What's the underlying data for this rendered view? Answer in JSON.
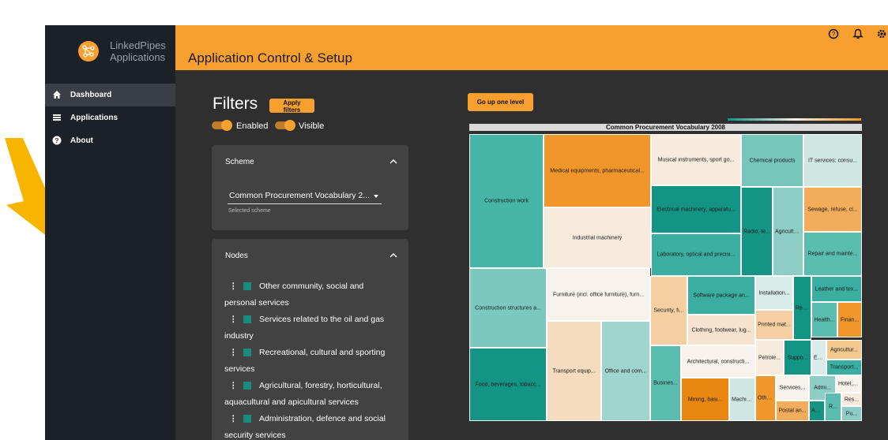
{
  "brand": {
    "line1": "LinkedPipes",
    "line2": "Applications"
  },
  "topbar": {
    "title": "Application Control & Setup",
    "icons": [
      "help-icon",
      "bell-icon",
      "gear-icon"
    ]
  },
  "nav": [
    {
      "label": "Dashboard",
      "icon": "home-icon",
      "active": true
    },
    {
      "label": "Applications",
      "icon": "list-icon",
      "active": false
    },
    {
      "label": "About",
      "icon": "help-circle-icon",
      "active": false
    }
  ],
  "filters": {
    "title": "Filters",
    "apply_label": "Apply filters",
    "enabled_label": "Enabled",
    "visible_label": "Visible"
  },
  "scheme": {
    "title": "Scheme",
    "value": "Common Procurement Vocabulary 2...",
    "helper": "Selected scheme"
  },
  "nodes": {
    "title": "Nodes",
    "items": [
      {
        "first": "Other community, social and",
        "rest": "personal services"
      },
      {
        "first": "Services related to the oil and gas",
        "rest": "industry"
      },
      {
        "first": "Recreational, cultural and sporting",
        "rest": "services"
      },
      {
        "first": "Agricultural, forestry, horticultural,",
        "rest": "aquacultural and apicultural services"
      },
      {
        "first": "Administration, defence and social",
        "rest": "security services"
      }
    ]
  },
  "viz": {
    "go_up_label": "Go up one level",
    "title": "Common Procurement Vocabulary 2008",
    "colors": {
      "accent": "#f7a030",
      "sidebar": "#1c2127",
      "background": "#2f2f2f"
    },
    "cells": [
      {
        "label": "Construction work",
        "color": "#45b5a8"
      },
      {
        "label": "Medical equipments, pharmaceutical...",
        "color": "#f0962a"
      },
      {
        "label": "Industrial machinery",
        "color": "#f7ebdd"
      },
      {
        "label": "Musical instruments, sport go...",
        "color": "#f7ebdd"
      },
      {
        "label": "Electrical machinery, apparatu...",
        "color": "#149484"
      },
      {
        "label": "Laboratory, optical and precisi...",
        "color": "#3aaea1"
      },
      {
        "label": "Chemical products",
        "color": "#76c6bc"
      },
      {
        "label": "IT services: consu...",
        "color": "#cfe7e3"
      },
      {
        "label": "Radio, te...",
        "color": "#149484"
      },
      {
        "label": "Agricultu...",
        "color": "#8dcdc5"
      },
      {
        "label": "Sewage, refuse, cl...",
        "color": "#f3ac5a"
      },
      {
        "label": "Repair and mainte...",
        "color": "#5bbcb0"
      },
      {
        "label": "Construction structures a...",
        "color": "#7ac8be"
      },
      {
        "label": "Furniture (incl. office furniture), furn...",
        "color": "#f7f2ec"
      },
      {
        "label": "Security, fi...",
        "color": "#f5cfa2"
      },
      {
        "label": "Software package an...",
        "color": "#3aaea1"
      },
      {
        "label": "Installation...",
        "color": "#d8ece9"
      },
      {
        "label": "Rec...",
        "color": "#149484"
      },
      {
        "label": "Leather and tex...",
        "color": "#3aaea1"
      },
      {
        "label": "Clothing, footwear, lug...",
        "color": "#f5e3cf"
      },
      {
        "label": "Printed mat...",
        "color": "#f5cfa2"
      },
      {
        "label": "Health...",
        "color": "#5bbcb0"
      },
      {
        "label": "Finan...",
        "color": "#f0962a"
      },
      {
        "label": "Food, beverages, tobacc...",
        "color": "#149484"
      },
      {
        "label": "Transport equip...",
        "color": "#f5dcbe"
      },
      {
        "label": "Office and com...",
        "color": "#9fd5ce"
      },
      {
        "label": "Busines...",
        "color": "#5bbcb0"
      },
      {
        "label": "Architectural, constructi...",
        "color": "#f7f2ec"
      },
      {
        "label": "Petrole...",
        "color": "#f7ebdd"
      },
      {
        "label": "Suppo...",
        "color": "#149484"
      },
      {
        "label": "Edu...",
        "color": "#d8ece9"
      },
      {
        "label": "Agricultur...",
        "color": "#f5c98e"
      },
      {
        "label": "Transport...",
        "color": "#3aaea1"
      },
      {
        "label": "Mining, basi...",
        "color": "#e8860f"
      },
      {
        "label": "Machiner...",
        "color": "#cfe7e3"
      },
      {
        "label": "Othe...",
        "color": "#f0962a"
      },
      {
        "label": "Services...",
        "color": "#f7f2ec"
      },
      {
        "label": "Admi...",
        "color": "#8dcdc5"
      },
      {
        "label": "Hotel, re...",
        "color": "#f7f2ec"
      },
      {
        "label": "Postal an...",
        "color": "#f3ac5a"
      },
      {
        "label": "Agric...",
        "color": "#149484"
      },
      {
        "label": "R...",
        "color": "#5bbcb0"
      },
      {
        "label": "Res...",
        "color": "#f7ebdd"
      },
      {
        "label": "Pu...",
        "color": "#8dcdc5"
      }
    ]
  }
}
